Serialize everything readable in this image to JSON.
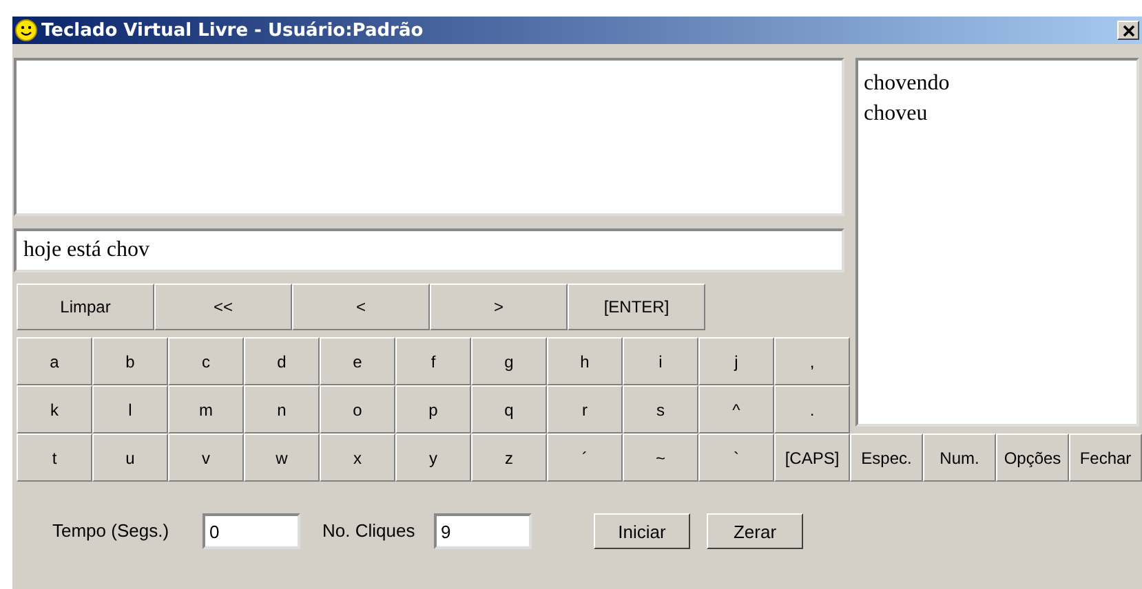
{
  "window": {
    "title": "Teclado Virtual Livre - Usuário:Padrão"
  },
  "input": {
    "value": "hoje está chov"
  },
  "suggestions": [
    "chovendo",
    "choveu"
  ],
  "edit_buttons": [
    "Limpar",
    "<<",
    "<",
    ">",
    "[ENTER]"
  ],
  "keys": [
    [
      "a",
      "b",
      "c",
      "d",
      "e",
      "f",
      "g",
      "h",
      "i",
      "j",
      ","
    ],
    [
      "k",
      "l",
      "m",
      "n",
      "o",
      "p",
      "q",
      "r",
      "s",
      "^",
      "."
    ],
    [
      "t",
      "u",
      "v",
      "w",
      "x",
      "y",
      "z",
      "´",
      "~",
      "`",
      "[CAPS]"
    ]
  ],
  "mode_buttons": [
    "Espec.",
    "Num.",
    "Opções",
    "Fechar"
  ],
  "counters": [
    {
      "label": "Tempo (Segs.)",
      "value": "0"
    },
    {
      "label": "No. Cliques",
      "value": "9"
    }
  ],
  "action_buttons": [
    "Iniciar",
    "Zerar"
  ]
}
